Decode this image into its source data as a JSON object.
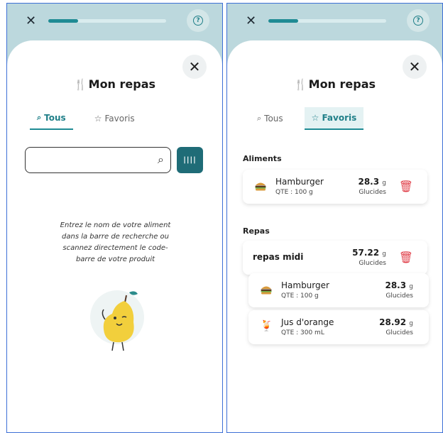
{
  "left": {
    "progress_pct": 25,
    "title": "Mon repas",
    "tabs": [
      {
        "label": "Tous",
        "active": true
      },
      {
        "label": "Favoris",
        "active": false
      }
    ],
    "search": {
      "value": "",
      "placeholder": ""
    },
    "empty_message": "Entrez le nom de votre aliment dans la barre de recherche ou scannez directement le code-barre de votre produit"
  },
  "right": {
    "progress_pct": 25,
    "title": "Mon repas",
    "tabs": [
      {
        "label": "Tous",
        "active": false
      },
      {
        "label": "Favoris",
        "active": true
      }
    ],
    "sections": {
      "aliments": "Aliments",
      "repas": "Repas"
    },
    "aliments": [
      {
        "name": "Hamburger",
        "qty": "QTE : 100 g",
        "value": "28.3",
        "unit_small": "g",
        "label": "Glucides"
      }
    ],
    "meal": {
      "name": "repas midi",
      "value": "57.22",
      "unit_small": "g",
      "label": "Glucides",
      "items": [
        {
          "name": "Hamburger",
          "qty": "QTE : 100 g",
          "value": "28.3",
          "unit_small": "g",
          "label": "Glucides"
        },
        {
          "name": "Jus d'orange",
          "qty": "QTE : 300 mL",
          "value": "28.92",
          "unit_small": "g",
          "label": "Glucides"
        }
      ]
    }
  },
  "colors": {
    "accent": "#1f8b94",
    "background": "#bcd8dd",
    "delete": "#e0404a"
  },
  "icons": {
    "close": "close-icon",
    "help": "help-icon",
    "search": "search-icon",
    "star": "star-icon",
    "barcode": "barcode-icon",
    "trash": "trash-icon",
    "cutlery": "cutlery-icon"
  }
}
